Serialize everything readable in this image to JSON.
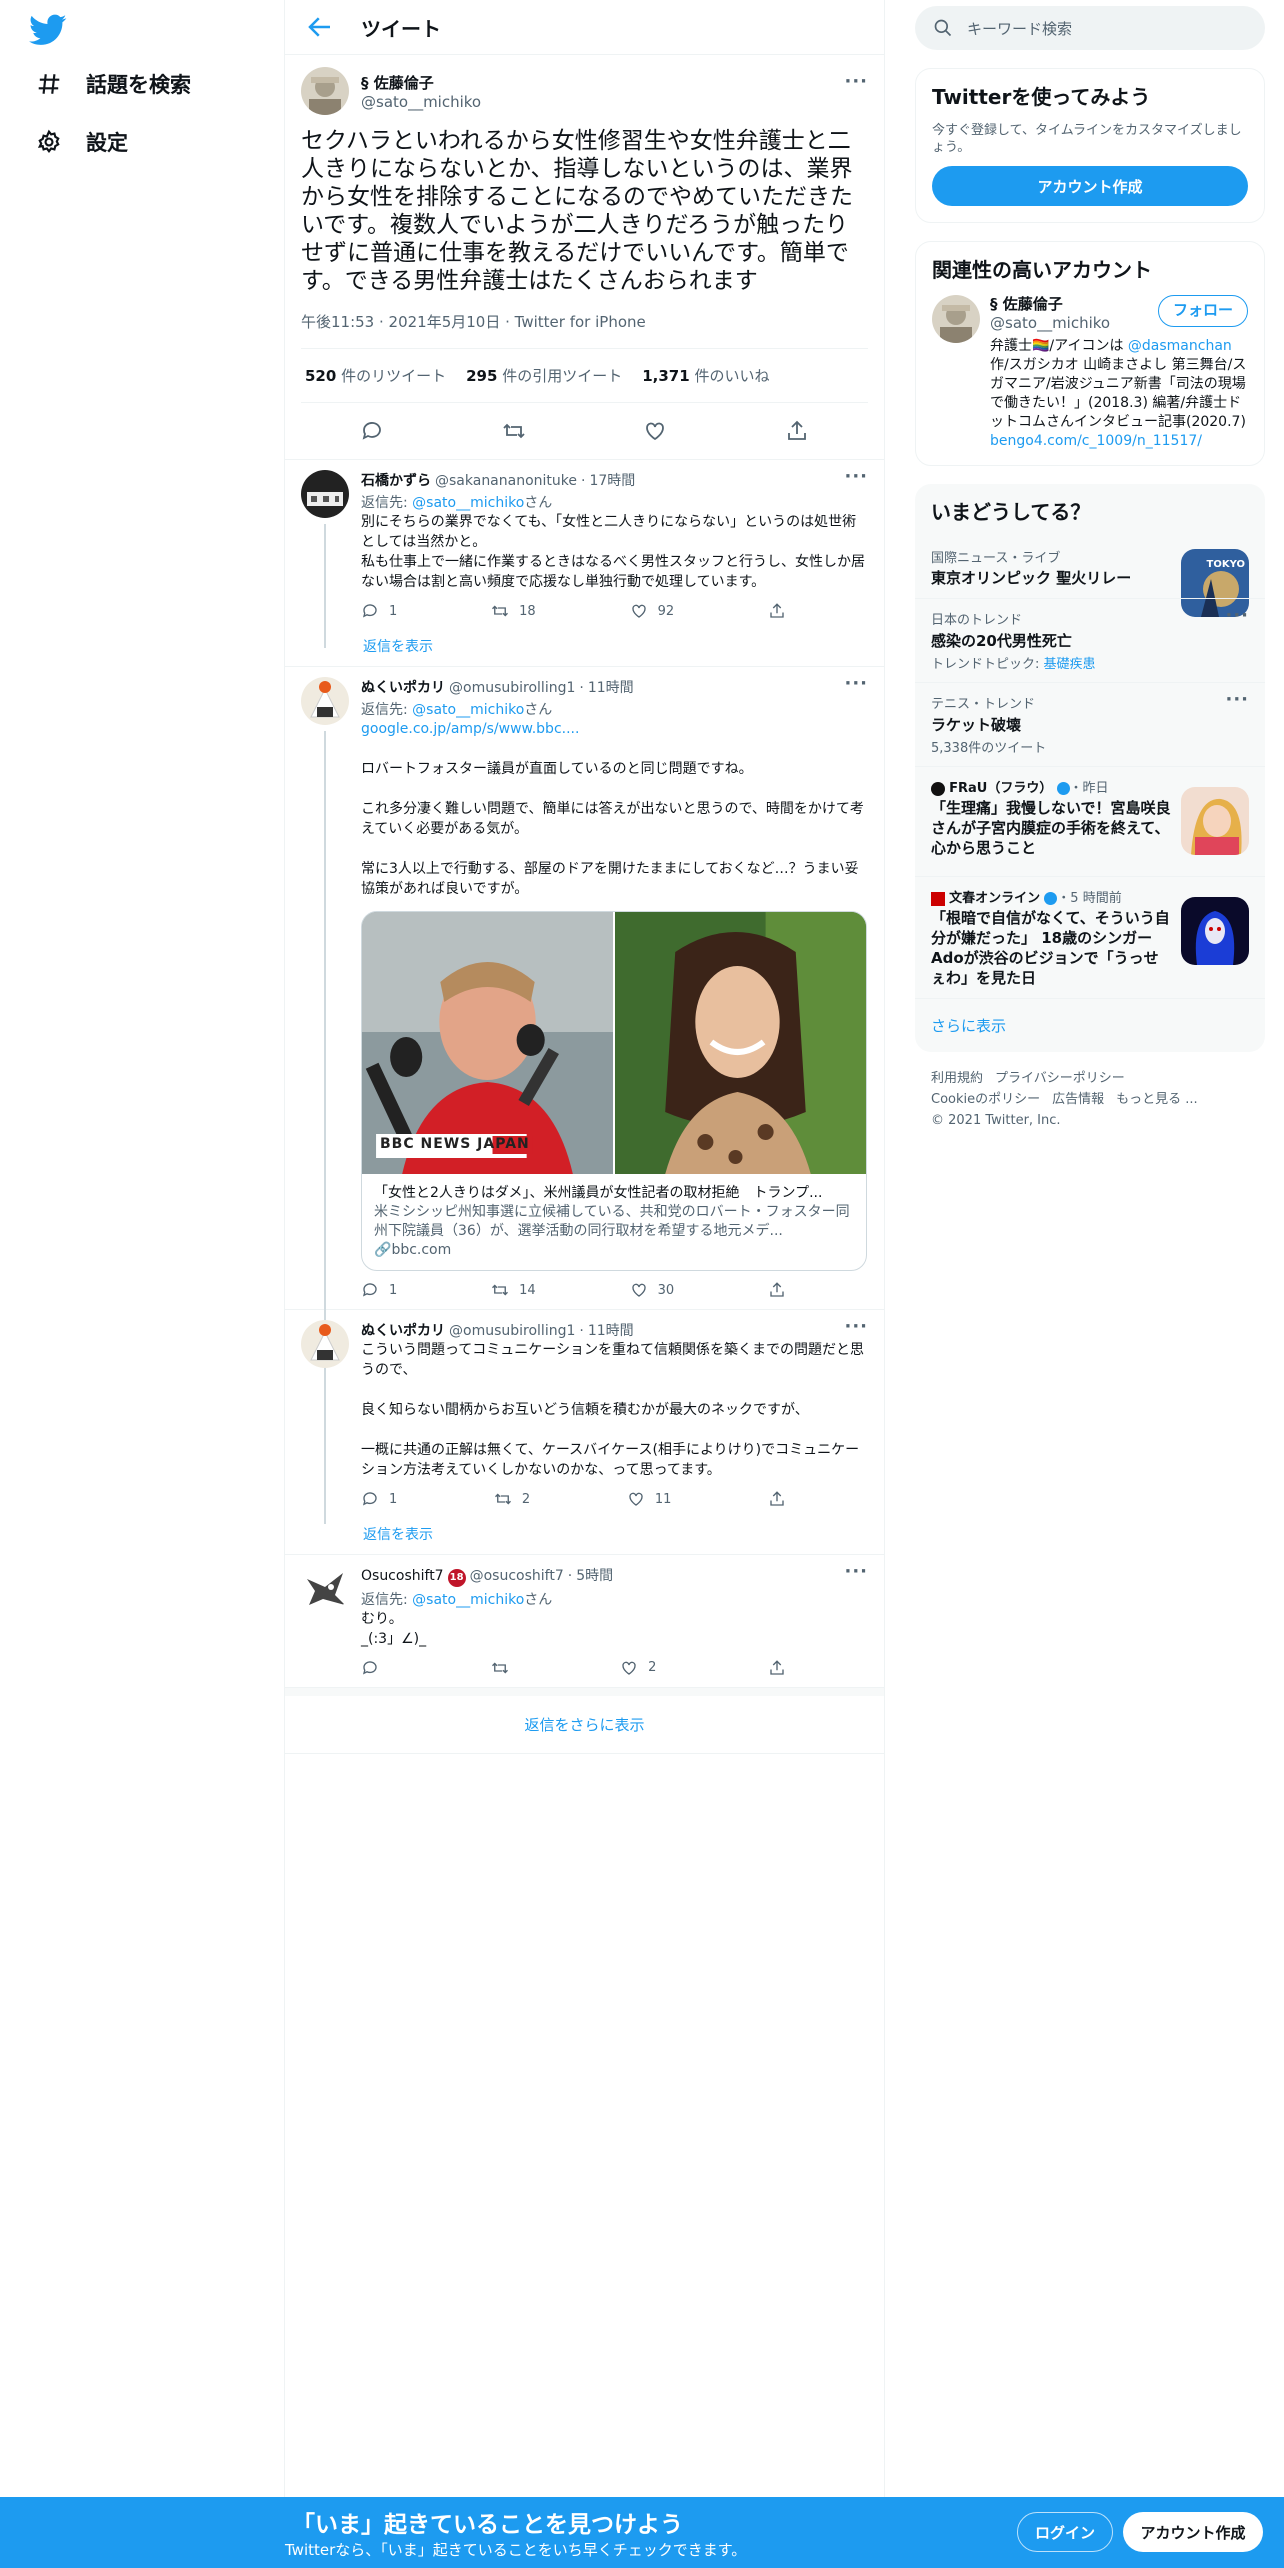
{
  "nav": {
    "items": [
      {
        "label": "話題を検索",
        "icon": "hashtag-icon"
      },
      {
        "label": "設定",
        "icon": "gear-icon"
      }
    ]
  },
  "header": {
    "title": "ツイート"
  },
  "focal": {
    "name": "§ 佐藤倫子",
    "handle": "@sato__michiko",
    "text": "セクハラといわれるから女性修習生や女性弁護士と二人きりにならないとか、指導しないというのは、業界から女性を排除することになるのでやめていただきたいです。複数人でいようが二人きりだろうが触ったりせずに普通に仕事を教えるだけでいいんです。簡単です。できる男性弁護士はたくさんおられます",
    "time": "午後11:53",
    "date": "2021年5月10日",
    "source": "Twitter for iPhone",
    "retweets": "520",
    "retweets_label": "件のリツイート",
    "quotes": "295",
    "quotes_label": "件の引用ツイート",
    "likes": "1,371",
    "likes_label": "件のいいね"
  },
  "replies": [
    {
      "name": "石橋かずら",
      "handle": "@sakanananonituke",
      "time": "17時間",
      "to_label": "返信先:",
      "to_handle": "@sato__michiko",
      "to_suffix": "さん",
      "text": "別にそちらの業界でなくても、「女性と二人きりにならない」というのは処世術としては当然かと。\n私も仕事上で一緒に作業するときはなるべく男性スタッフと行うし、女性しか居ない場合は割と高い頻度で応援なし単独行動で処理しています。",
      "replies": "1",
      "retweets": "18",
      "likes": "92",
      "show_replies": "返信を表示"
    },
    {
      "name": "ぬくいポカリ",
      "handle": "@omusubirolling1",
      "time": "11時間",
      "to_label": "返信先:",
      "to_handle": "@sato__michiko",
      "to_suffix": "さん",
      "link": "google.co.jp/amp/s/www.bbc....",
      "text": "ロバートフォスター議員が直面しているのと同じ問題ですね。\n\nこれ多分凄く難しい問題で、簡単には答えが出ないと思うので、時間をかけて考えていく必要がある気が。\n\n常に3人以上で行動する、部屋のドアを開けたままにしておくなど…？うまい妥協策があれば良いですが。",
      "card_title": "「女性と2人きりはダメ」、米州議員が女性記者の取材拒絶　トランプ...",
      "card_desc": "米ミシシッピ州知事選に立候補している、共和党のロバート・フォスター同州下院議員（36）が、選挙活動の同行取材を希望する地元メデ...",
      "card_domain": "bbc.com",
      "card_brand": "BBC NEWS JAPAN",
      "replies": "1",
      "retweets": "14",
      "likes": "30"
    },
    {
      "name": "ぬくいポカリ",
      "handle": "@omusubirolling1",
      "time": "11時間",
      "text": "こういう問題ってコミュニケーションを重ねて信頼関係を築くまでの問題だと思うので、\n\n良く知らない間柄からお互いどう信頼を積むかが最大のネックですが、\n\n一概に共通の正解は無くて、ケースバイケース(相手によりけり)でコミュニケーション方法考えていくしかないのかな、って思ってます。",
      "replies": "1",
      "retweets": "2",
      "likes": "11",
      "show_replies": "返信を表示"
    },
    {
      "name": "Osucoshift7",
      "badge": "18",
      "handle": "@osucoshift7",
      "time": "5時間",
      "to_label": "返信先:",
      "to_handle": "@sato__michiko",
      "to_suffix": "さん",
      "text": "むり。\n_(:3」∠)_",
      "likes": "2"
    }
  ],
  "more_replies": "返信をさらに表示",
  "search": {
    "placeholder": "キーワード検索"
  },
  "signup_panel": {
    "title": "Twitterを使ってみよう",
    "desc": "今すぐ登録して、タイムラインをカスタマイズしましょう。",
    "button": "アカウント作成"
  },
  "related": {
    "title": "関連性の高いアカウント",
    "name": "§ 佐藤倫子",
    "handle": "@sato__michiko",
    "follow": "フォロー",
    "bio_pre": "弁護士🏳️‍🌈/アイコンは ",
    "bio_mention": "@dasmanchan",
    "bio_post": " 作/スガシカオ 山崎まさよし 第三舞台/スガマニア/岩波ジュニア新書「司法の現場で働きたい！」(2018.3) 編著/弁護士ドットコムさんインタビュー記事(2020.7)",
    "bio_link": "bengo4.com/c_1009/n_11517/"
  },
  "trends": {
    "title": "いまどうしてる？",
    "items": [
      {
        "context": "国際ニュース・ライブ",
        "title": "東京オリンピック 聖火リレー",
        "thumb": "TOKYO"
      },
      {
        "context": "日本のトレンド",
        "title": "感染の20代男性死亡",
        "sub_label": "トレンドトピック: ",
        "sub_link": "基礎疾患"
      },
      {
        "context": "テニス・トレンド",
        "title": "ラケット破壊",
        "sub": "5,338件のツイート"
      },
      {
        "context_name": "FRaU（フラウ）",
        "context_time": "・昨日",
        "title": "「生理痛」我慢しないで！宮島咲良さんが子宮内膜症の手術を終えて、心から思うこと"
      },
      {
        "context_name": "文春オンライン",
        "context_time": "・5 時間前",
        "title": "「根暗で自信がなくて、そういう自分が嫌だった」 18歳のシンガーAdoが渋谷のビジョンで「うっせぇわ」を見た日"
      }
    ],
    "show_more": "さらに表示"
  },
  "footer": {
    "links": [
      "利用規約",
      "プライバシーポリシー",
      "Cookieのポリシー",
      "広告情報",
      "もっと見る ..."
    ],
    "copyright": "© 2021 Twitter, Inc."
  },
  "bottombar": {
    "title": "「いま」起きていることを見つけよう",
    "subtitle": "Twitterなら、「いま」起きていることをいち早くチェックできます。",
    "login": "ログイン",
    "signup": "アカウント作成"
  },
  "colors": {
    "accent": "#1d9bf0",
    "text": "#0f1419",
    "secondary": "#536471"
  }
}
